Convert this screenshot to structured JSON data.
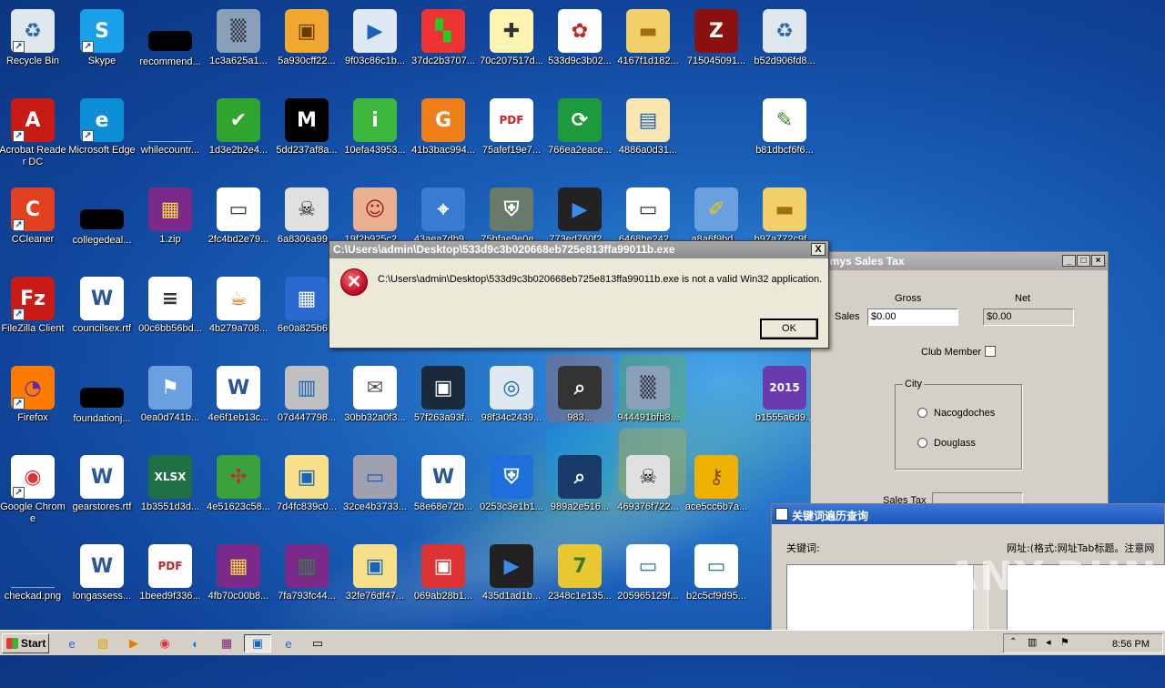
{
  "desktop": {
    "icons": [
      {
        "label": "Recycle Bin",
        "icon": "recycle-bin-icon"
      },
      {
        "label": "Skype",
        "icon": "skype-icon"
      },
      {
        "label": "recommend...",
        "icon": "black-thumbnail-icon"
      },
      {
        "label": "1c3a625a1...",
        "icon": "noise-image-icon"
      },
      {
        "label": "5a930cff22...",
        "icon": "package-icon"
      },
      {
        "label": "9f03c86c1b...",
        "icon": "media-player-icon"
      },
      {
        "label": "37dc2b3707...",
        "icon": "colored-squares-icon"
      },
      {
        "label": "70c207517d...",
        "icon": "clipboard-installer-icon"
      },
      {
        "label": "533d9c3b02...",
        "icon": "pattern-icon"
      },
      {
        "label": "4167f1d182...",
        "icon": "folder-icon"
      },
      {
        "label": "715045091...",
        "icon": "red-app-icon"
      },
      {
        "label": "b52d906fd8...",
        "icon": "recycle-bin-icon"
      },
      {
        "label": "Acrobat Reader DC",
        "icon": "acrobat-icon"
      },
      {
        "label": "Microsoft Edge",
        "icon": "edge-icon"
      },
      {
        "label": "whilecountr...",
        "icon": "blank-file-icon"
      },
      {
        "label": "1d3e2b2e4...",
        "icon": "shield-check-icon"
      },
      {
        "label": "5dd237af8a...",
        "icon": "m-logo-icon"
      },
      {
        "label": "10efa43953...",
        "icon": "info-icon"
      },
      {
        "label": "41b3bac994...",
        "icon": "orange-box-icon"
      },
      {
        "label": "75afef19e7...",
        "icon": "pdf-icon"
      },
      {
        "label": "766ea2eace...",
        "icon": "sync-arrows-icon"
      },
      {
        "label": "4886a0d31...",
        "icon": "book-icon"
      },
      {
        "label": "b81dbcf6f6...",
        "icon": "certificate-icon"
      },
      {
        "label": "CCleaner",
        "icon": "ccleaner-icon"
      },
      {
        "label": "collegedeal...",
        "icon": "black-thumbnail-icon"
      },
      {
        "label": "1.zip",
        "icon": "winrar-icon"
      },
      {
        "label": "2fc4bd2e79...",
        "icon": "window-file-icon"
      },
      {
        "label": "6a8306a99...",
        "icon": "skull-icon"
      },
      {
        "label": "19f2b925c2...",
        "icon": "anime-face-icon"
      },
      {
        "label": "43aea7db9...",
        "icon": "network-icon"
      },
      {
        "label": "75bfae9e0e...",
        "icon": "shield-image-icon"
      },
      {
        "label": "773ed760f2...",
        "icon": "clapper-icon"
      },
      {
        "label": "6468be242...",
        "icon": "window-icon"
      },
      {
        "label": "a8a6f9bd...",
        "icon": "brush-icon"
      },
      {
        "label": "b97a772c9f...",
        "icon": "folder-icon"
      },
      {
        "label": "FileZilla Client",
        "icon": "filezilla-icon"
      },
      {
        "label": "councilsex.rtf",
        "icon": "word-doc-icon"
      },
      {
        "label": "00c6bb56bd...",
        "icon": "text-doc-icon"
      },
      {
        "label": "4b279a708...",
        "icon": "java-icon"
      },
      {
        "label": "6e0a825b6...",
        "icon": "calculator-icon"
      },
      {
        "label": "Firefox",
        "icon": "firefox-icon"
      },
      {
        "label": "foundationj...",
        "icon": "black-thumbnail-icon"
      },
      {
        "label": "0ea0d741b...",
        "icon": "windows-flag-icon"
      },
      {
        "label": "4e6f1eb13c...",
        "icon": "word-doc-icon"
      },
      {
        "label": "07d447798...",
        "icon": "computer-icon"
      },
      {
        "label": "30bb32a0f3...",
        "icon": "envelope-icon"
      },
      {
        "label": "57f263a93f...",
        "icon": "id-card-icon"
      },
      {
        "label": "98f34c2439...",
        "icon": "cd-installer-icon"
      },
      {
        "label": "983...",
        "icon": "search-camera-icon"
      },
      {
        "label": "944491bfb8...",
        "icon": "noise-image-icon"
      },
      {
        "label": "b1555a6d9...",
        "icon": "badge-2015-icon"
      },
      {
        "label": "Google Chrome",
        "icon": "chrome-icon"
      },
      {
        "label": "gearstores.rtf",
        "icon": "word-doc-icon"
      },
      {
        "label": "1b3551d3d...",
        "icon": "xlsx-icon"
      },
      {
        "label": "4e51623c58...",
        "icon": "map-image-icon"
      },
      {
        "label": "7d4fc839c0...",
        "icon": "installer-icon"
      },
      {
        "label": "32ce4b3733...",
        "icon": "laptop-icon"
      },
      {
        "label": "58e68e72b...",
        "icon": "word-doc-icon"
      },
      {
        "label": "0253c3e1b1...",
        "icon": "shield-pulse-icon"
      },
      {
        "label": "989a2e516...",
        "icon": "monitor-search-icon"
      },
      {
        "label": "469376f722...",
        "icon": "skull-icon"
      },
      {
        "label": "ace5cc6b7a...",
        "icon": "key-icon"
      },
      {
        "label": "checkad.png",
        "icon": "blank-file-icon"
      },
      {
        "label": "longassess...",
        "icon": "word-doc-icon"
      },
      {
        "label": "1beed9f336...",
        "icon": "pdf-icon"
      },
      {
        "label": "4fb70c00b8...",
        "icon": "winrar-icon"
      },
      {
        "label": "7fa793fc44...",
        "icon": "winrar-books-icon"
      },
      {
        "label": "32fe76df47...",
        "icon": "installer-icon"
      },
      {
        "label": "069ab28b1...",
        "icon": "setup-box-icon"
      },
      {
        "label": "435d1ad1b...",
        "icon": "clapper-icon"
      },
      {
        "label": "2348c1e135...",
        "icon": "seven-icon"
      },
      {
        "label": "205965129f...",
        "icon": "screen-image-icon"
      },
      {
        "label": "b2c5cf9d95...",
        "icon": "screen-image-icon"
      }
    ]
  },
  "error_dialog": {
    "title": "C:\\Users\\admin\\Desktop\\533d9c3b020668eb725e813ffa99011b.exe",
    "message": "C:\\Users\\admin\\Desktop\\533d9c3b020668eb725e813ffa99011b.exe is not a valid Win32 application.",
    "ok_label": "OK",
    "close_label": "X"
  },
  "sales_tax_window": {
    "title": "mmys Sales Tax",
    "gross_label": "Gross",
    "net_label": "Net",
    "sales_label": "Sales",
    "sales_gross_value": "$0.00",
    "sales_net_value": "$0.00",
    "club_member_label": "Club Member",
    "club_member_checked": false,
    "city_group_label": "City",
    "city_options": [
      "Nacogdoches",
      "Douglass"
    ],
    "sales_tax_label": "Sales Tax"
  },
  "keyword_window": {
    "title": "关键词遍历查询",
    "keyword_label": "关键词:",
    "url_label": "网址:(格式:网址Tab标题。注意网"
  },
  "watermark": {
    "text": "ANY.RUN"
  },
  "taskbar": {
    "start_label": "Start",
    "clock": "8:56 PM"
  }
}
